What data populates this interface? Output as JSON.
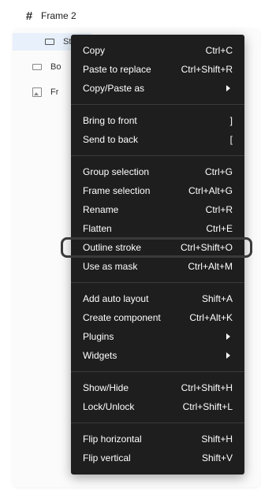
{
  "layers": {
    "frame_title": "Frame 2",
    "frame_icon": "hash-icon",
    "rows": [
      {
        "label": "St",
        "icon": "rectangle-icon",
        "selected": true
      },
      {
        "label": "Bo",
        "icon": "rectangle-icon",
        "selected": false
      },
      {
        "label": "Fr",
        "icon": "image-icon",
        "selected": false
      }
    ]
  },
  "menu": {
    "groups": [
      [
        {
          "label": "Copy",
          "shortcut": "Ctrl+C"
        },
        {
          "label": "Paste to replace",
          "shortcut": "Ctrl+Shift+R"
        },
        {
          "label": "Copy/Paste as",
          "submenu": true
        }
      ],
      [
        {
          "label": "Bring to front",
          "shortcut": "]"
        },
        {
          "label": "Send to back",
          "shortcut": "["
        }
      ],
      [
        {
          "label": "Group selection",
          "shortcut": "Ctrl+G"
        },
        {
          "label": "Frame selection",
          "shortcut": "Ctrl+Alt+G"
        },
        {
          "label": "Rename",
          "shortcut": "Ctrl+R"
        },
        {
          "label": "Flatten",
          "shortcut": "Ctrl+E"
        },
        {
          "label": "Outline stroke",
          "shortcut": "Ctrl+Shift+O",
          "highlighted": true
        },
        {
          "label": "Use as mask",
          "shortcut": "Ctrl+Alt+M"
        }
      ],
      [
        {
          "label": "Add auto layout",
          "shortcut": "Shift+A"
        },
        {
          "label": "Create component",
          "shortcut": "Ctrl+Alt+K"
        },
        {
          "label": "Plugins",
          "submenu": true
        },
        {
          "label": "Widgets",
          "submenu": true
        }
      ],
      [
        {
          "label": "Show/Hide",
          "shortcut": "Ctrl+Shift+H"
        },
        {
          "label": "Lock/Unlock",
          "shortcut": "Ctrl+Shift+L"
        }
      ],
      [
        {
          "label": "Flip horizontal",
          "shortcut": "Shift+H"
        },
        {
          "label": "Flip vertical",
          "shortcut": "Shift+V"
        }
      ]
    ]
  },
  "colors": {
    "menu_bg": "#1e1e1e",
    "menu_text": "#ffffff",
    "separator": "#3b3b3b",
    "highlight_ring": "#3a3a3a",
    "selected_layer_bg": "#e7f0fb"
  }
}
